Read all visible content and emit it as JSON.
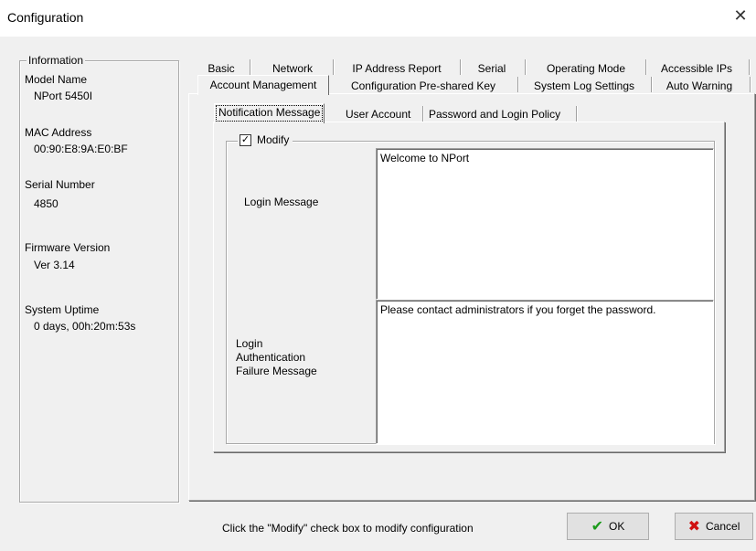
{
  "window": {
    "title": "Configuration",
    "close_icon": "close-icon"
  },
  "info": {
    "legend": "Information",
    "model_label": "Model Name",
    "model_value": "NPort 5450I",
    "mac_label": "MAC Address",
    "mac_value": "00:90:E8:9A:E0:BF",
    "serial_label": "Serial Number",
    "serial_value": "4850",
    "firmware_label": "Firmware Version",
    "firmware_value": "Ver 3.14",
    "uptime_label": "System Uptime",
    "uptime_value": "0 days, 00h:20m:53s"
  },
  "tabs_row1": [
    "Basic",
    "Network",
    "IP Address Report",
    "Serial",
    "Operating Mode",
    "Accessible IPs"
  ],
  "tabs_row2": [
    "Account Management",
    "Configuration Pre-shared Key",
    "System Log Settings",
    "Auto Warning"
  ],
  "active_tab": "Account Management",
  "inner_tabs": [
    "Notification Message",
    "User Account",
    "Password and Login Policy"
  ],
  "active_inner_tab": "Notification Message",
  "modify": {
    "label": "Modify",
    "checked": true,
    "check_glyph": "✓",
    "login_message_label": "Login Message",
    "login_message_value": "Welcome to NPort",
    "failure_label_line1": "Login",
    "failure_label_line2": "Authentication",
    "failure_label_line3": "Failure Message",
    "failure_value": "Please contact administrators if you forget the password."
  },
  "status_text": "Click the \"Modify\" check box to modify configuration",
  "buttons": {
    "ok_label": "OK",
    "ok_icon": "check-icon",
    "cancel_label": "Cancel",
    "cancel_icon": "x-icon"
  },
  "colors": {
    "ok_check": "#1a9a1a",
    "cancel_x": "#d01010"
  }
}
